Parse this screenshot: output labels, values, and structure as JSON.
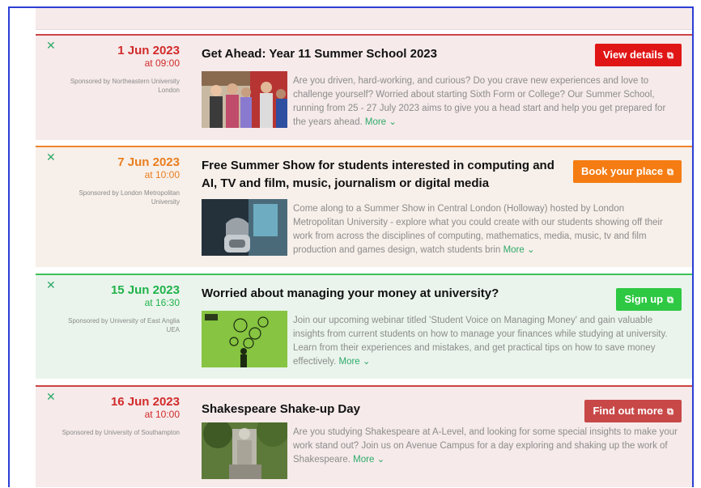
{
  "events": [
    {
      "date": "1 Jun 2023",
      "time": "at 09:00",
      "sponsor": "Sponsored by Northeastern University London",
      "title": "Get Ahead: Year 11 Summer School 2023",
      "cta": "View details",
      "description": "Are you driven, hard-working, and curious? Do you crave new experiences and love to challenge yourself? Worried about starting Sixth Form or College? Our Summer School, running from 25 - 27 July 2023 aims to give you a head start and help you get prepared for the years ahead.",
      "more": "More"
    },
    {
      "date": "7 Jun 2023",
      "time": "at 10:00",
      "sponsor": "Sponsored by London Metropolitan University",
      "title": "Free Summer Show for students interested in computing and AI, TV and film, music, journalism or digital media",
      "cta": "Book your place",
      "description": "Come along to a Summer Show in Central London (Holloway) hosted by London Metropolitan University - explore what you could create with our students showing off their work from across the disciplines of computing, mathematics, media, music, tv and film production and games design, watch students brin",
      "more": "More"
    },
    {
      "date": "15 Jun 2023",
      "time": "at 16:30",
      "sponsor": "Sponsored by University of East Anglia UEA",
      "title": "Worried about managing your money at university?",
      "cta": "Sign up",
      "description": "Join our upcoming webinar titled 'Student Voice on Managing Money' and gain valuable insights from current students on how to manage your finances while studying at university. Learn from their experiences and mistakes, and get practical tips on how to save money effectively.",
      "more": "More"
    },
    {
      "date": "16 Jun 2023",
      "time": "at 10:00",
      "sponsor": "Sponsored by University of Southampton",
      "title": "Shakespeare Shake-up Day",
      "cta": "Find out more",
      "description": "Are you studying Shakespeare at A-Level, and looking for some special insights to make your work stand out? Join us on Avenue Campus for a day exploring and shaking up the work of Shakespeare.",
      "more": "More"
    }
  ],
  "icons": {
    "dismiss": "close-x-icon",
    "external": "external-link-icon",
    "more": "chevron-down-icon"
  },
  "colors": {
    "red": "#d12b2b",
    "orange": "#e97e1f",
    "green": "#20b24a",
    "link": "#2faa6a"
  }
}
